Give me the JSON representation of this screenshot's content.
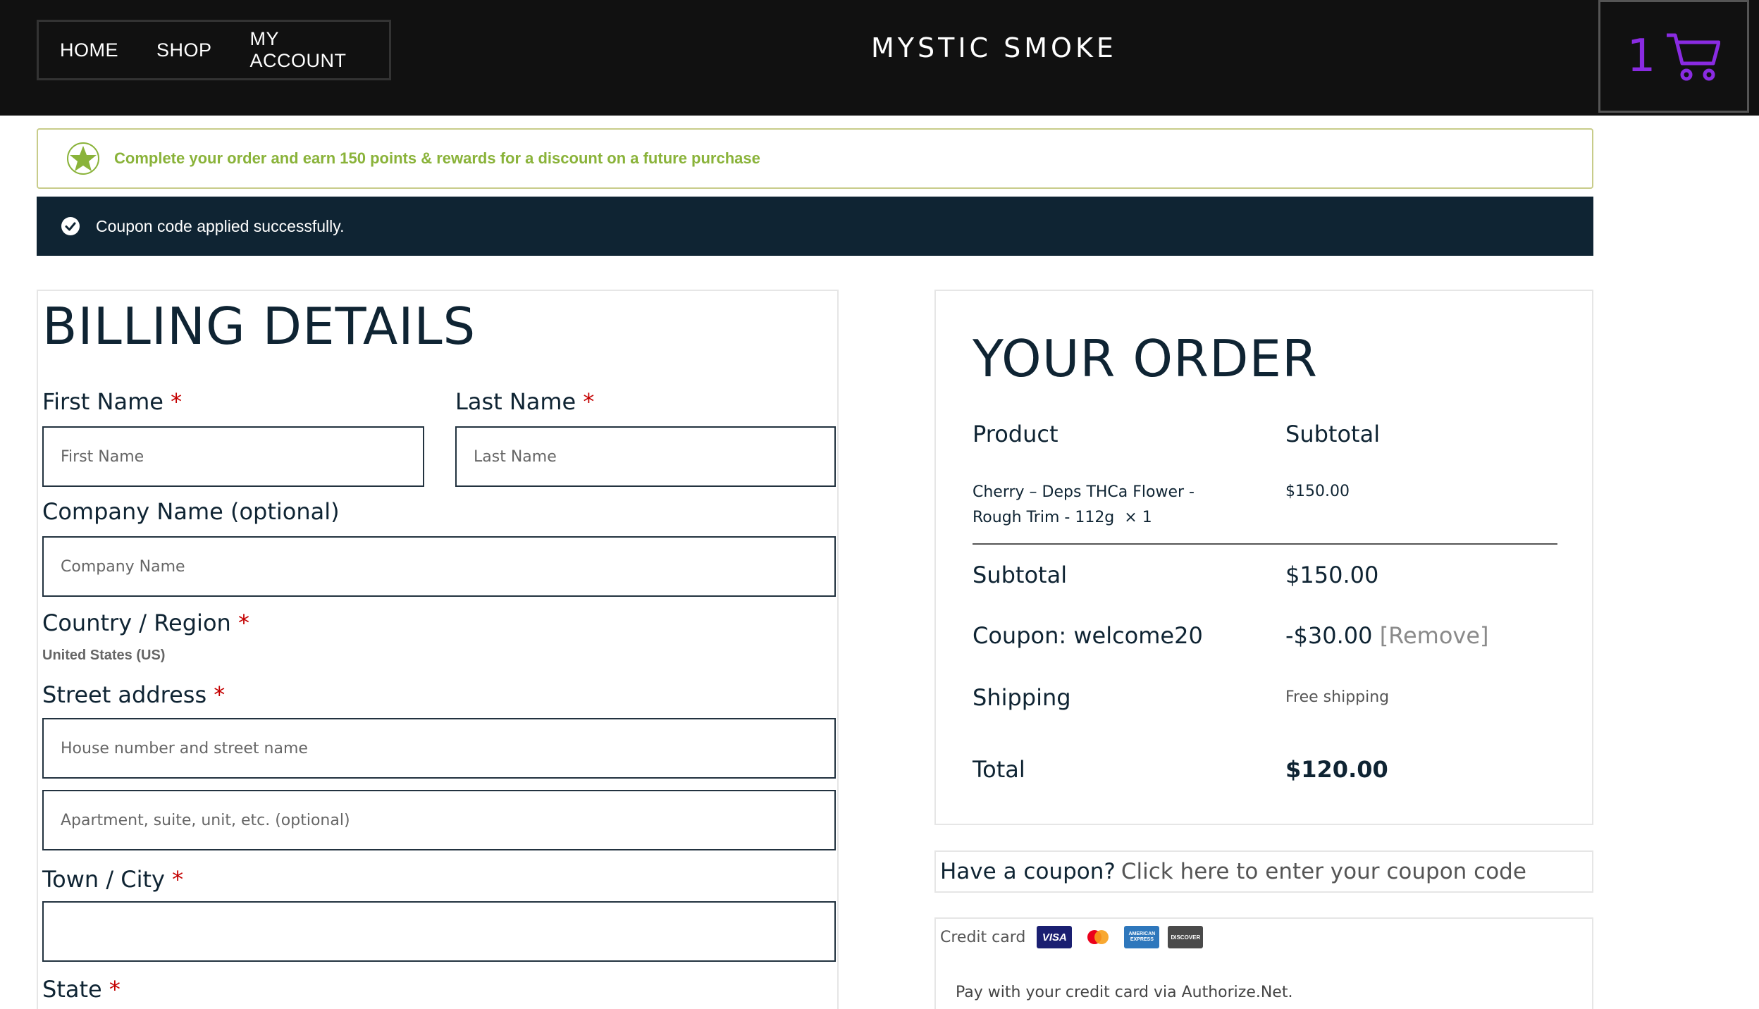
{
  "header": {
    "nav": [
      "HOME",
      "SHOP",
      "MY ACCOUNT"
    ],
    "brand": "MYSTIC SMOKE",
    "cart_count": "1"
  },
  "notices": {
    "rewards": "Complete your order and earn 150 points & rewards for a discount on a future purchase",
    "coupon_success": "Coupon code applied successfully."
  },
  "billing": {
    "title": "BILLING DETAILS",
    "first_name": {
      "label": "First Name",
      "placeholder": "First Name"
    },
    "last_name": {
      "label": "Last Name",
      "placeholder": "Last Name"
    },
    "company": {
      "label": "Company Name (optional)",
      "placeholder": "Company Name"
    },
    "country": {
      "label": "Country / Region",
      "value": "United States (US)"
    },
    "street": {
      "label": "Street address",
      "placeholder": "House number and street name",
      "placeholder2": "Apartment, suite, unit, etc. (optional)"
    },
    "city": {
      "label": "Town / City",
      "placeholder": ""
    },
    "state": {
      "label": "State"
    },
    "required_mark": "*"
  },
  "order": {
    "title": "YOUR ORDER",
    "col_product": "Product",
    "col_subtotal": "Subtotal",
    "item_name": "Cherry – Deps THCa Flower -",
    "item_name2": "Rough Trim - 112g",
    "item_qty": "× 1",
    "item_price": "$150.00",
    "rows": {
      "subtotal_label": "Subtotal",
      "subtotal_value": "$150.00",
      "coupon_label": "Coupon: welcome20",
      "coupon_value": "-$30.00",
      "coupon_remove": "[Remove]",
      "shipping_label": "Shipping",
      "shipping_value": "Free shipping",
      "total_label": "Total",
      "total_value": "$120.00"
    }
  },
  "coupon_toggle": {
    "question": "Have a coupon?",
    "link": "Click here to enter your coupon code"
  },
  "payment": {
    "method": "Credit card",
    "cards": [
      "VISA",
      "mastercard",
      "AMERICAN EXPRESS",
      "DISCOVER"
    ],
    "description": "Pay with your credit card via Authorize.Net."
  },
  "colors": {
    "header_bg": "#111111",
    "accent_purple": "#8a2be2",
    "notice_green": "#8ab33a",
    "success_bg": "#0f2433",
    "required_red": "#c40000"
  }
}
